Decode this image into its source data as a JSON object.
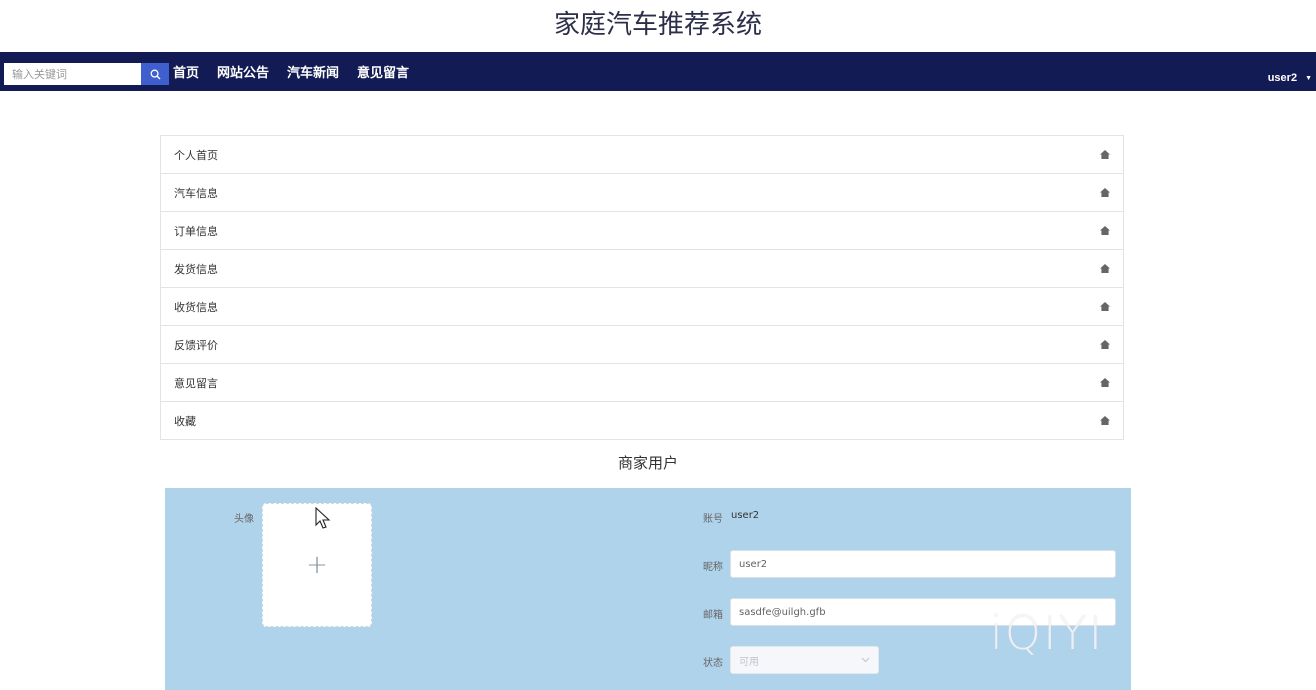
{
  "site": {
    "title": "家庭汽车推荐系统"
  },
  "navbar": {
    "search_placeholder": "输入关键词",
    "links": [
      "首页",
      "网站公告",
      "汽车新闻",
      "意见留言"
    ],
    "user": "user2",
    "bg_color": "#131b55",
    "search_button_color": "#3f5fcf"
  },
  "menu": {
    "items": [
      "个人首页",
      "汽车信息",
      "订单信息",
      "发货信息",
      "收货信息",
      "反馈评价",
      "意见留言",
      "收藏"
    ],
    "item_icon": "home-icon"
  },
  "profile": {
    "title": "商家用户",
    "panel_color": "#b0d3ec",
    "avatar_label": "头像",
    "avatar_upload_icon": "plus-icon",
    "account_label": "账号",
    "account_value": "user2",
    "nickname_label": "昵称",
    "nickname_value": "user2",
    "email_label": "邮箱",
    "email_value": "sasdfe@uilgh.gfb",
    "status_label": "状态",
    "status_value": "可用"
  },
  "watermark": "iQIYI"
}
